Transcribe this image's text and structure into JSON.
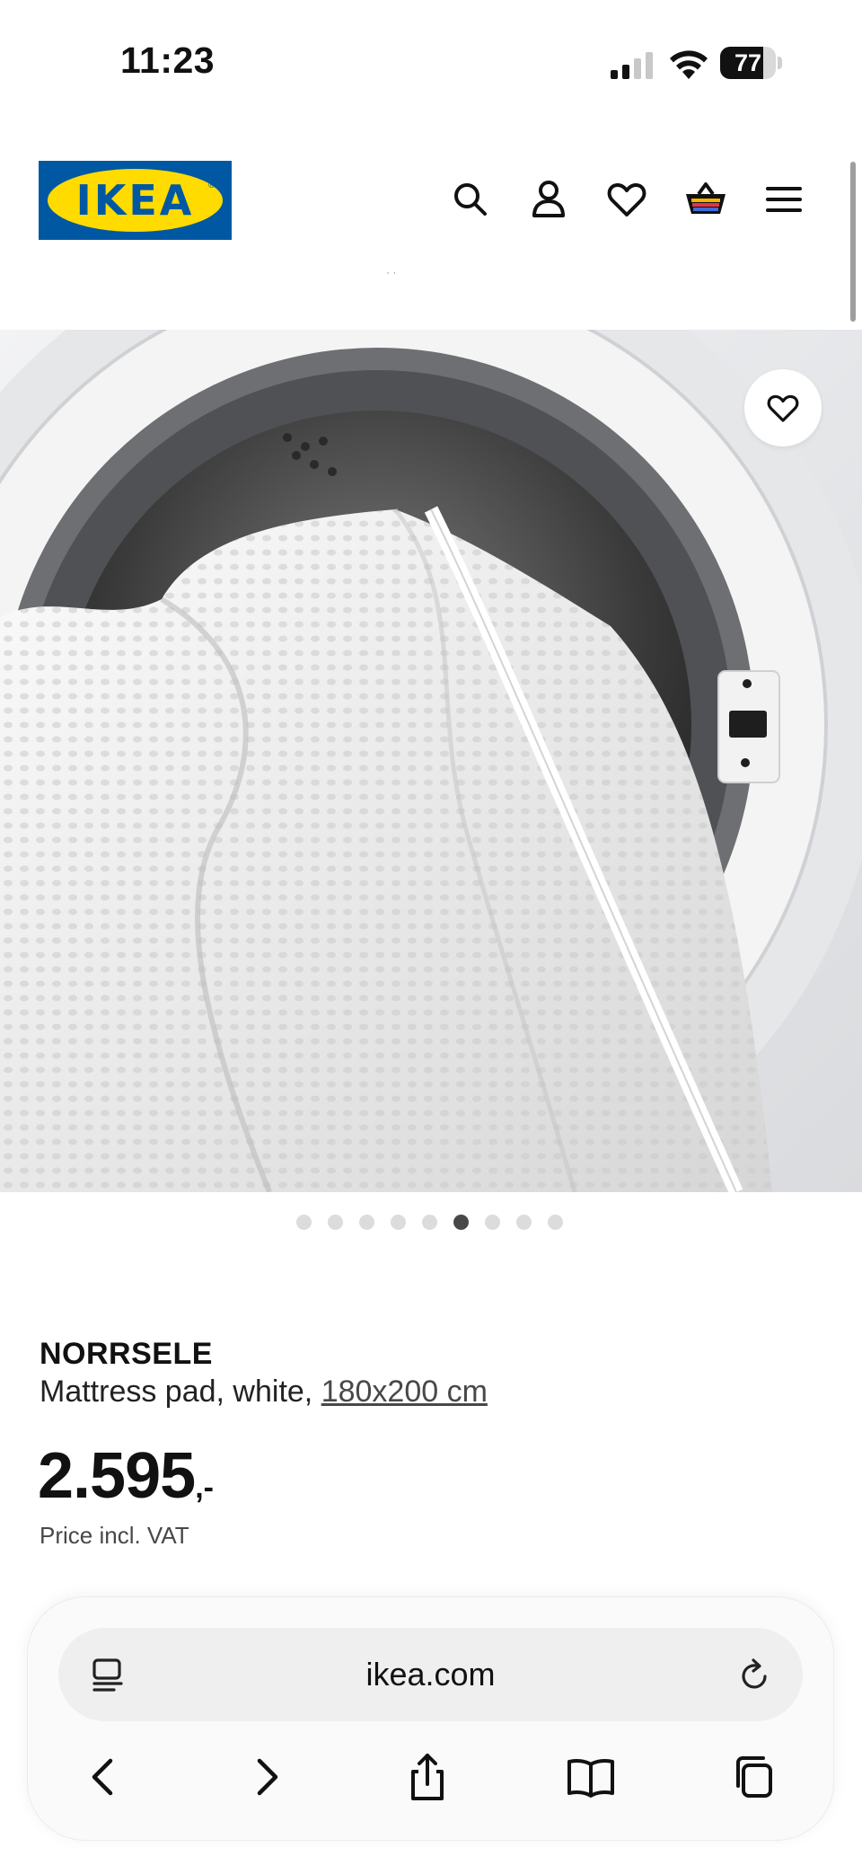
{
  "status_bar": {
    "time": "11:23",
    "battery_percent": "77",
    "battery_level": 0.77
  },
  "header": {
    "logo_text": "IKEA",
    "logo_registered": "®",
    "icons": [
      "search-icon",
      "account-icon",
      "heart-icon",
      "basket-icon",
      "menu-icon"
    ]
  },
  "gallery": {
    "image_count": 9,
    "active_index": 5,
    "favourite_icon": "heart-icon"
  },
  "product": {
    "name": "NORRSELE",
    "description": "Mattress pad, white, ",
    "size": "180x200 cm",
    "price": "2.595",
    "price_suffix": ",-",
    "vat_note": "Price incl. VAT"
  },
  "browser": {
    "url": "ikea.com",
    "icons": [
      "reader-icon",
      "reload-icon",
      "back-icon",
      "forward-icon",
      "share-icon",
      "bookmarks-icon",
      "tabs-icon"
    ]
  },
  "colors": {
    "ikea_blue": "#0058a3",
    "ikea_yellow": "#ffdb00",
    "text": "#111111",
    "muted": "#484848"
  }
}
